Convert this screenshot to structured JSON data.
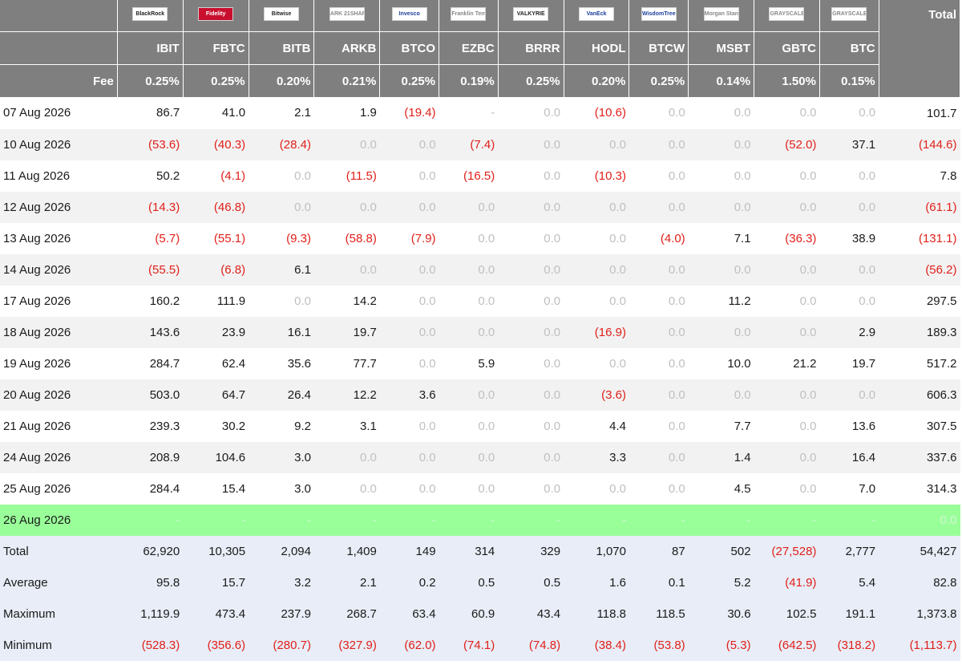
{
  "header": {
    "total_label": "Total",
    "fee_label": "Fee",
    "logos": [
      "BlackRock",
      "Fidelity",
      "Bitwise",
      "ARK 21SHARES",
      "Invesco",
      "Franklin Templeton",
      "VALKYRIE",
      "VanEck",
      "WisdomTree",
      "Morgan Stanley",
      "GRAYSCALE",
      "GRAYSCALE"
    ],
    "tickers": [
      "IBIT",
      "FBTC",
      "BITB",
      "ARKB",
      "BTCO",
      "EZBC",
      "BRRR",
      "HODL",
      "BTCW",
      "MSBT",
      "GBTC",
      "BTC"
    ],
    "fees": [
      "0.25%",
      "0.25%",
      "0.20%",
      "0.21%",
      "0.25%",
      "0.19%",
      "0.25%",
      "0.20%",
      "0.25%",
      "0.14%",
      "1.50%",
      "0.15%"
    ]
  },
  "rows": [
    {
      "date": "07 Aug 2026",
      "values": [
        "86.7",
        "41.0",
        "2.1",
        "1.9",
        "(19.4)",
        "-",
        "0.0",
        "(10.6)",
        "0.0",
        "0.0",
        "0.0",
        "0.0"
      ],
      "total": "101.7"
    },
    {
      "date": "10 Aug 2026",
      "values": [
        "(53.6)",
        "(40.3)",
        "(28.4)",
        "0.0",
        "0.0",
        "(7.4)",
        "0.0",
        "0.0",
        "0.0",
        "0.0",
        "(52.0)",
        "37.1"
      ],
      "total": "(144.6)"
    },
    {
      "date": "11 Aug 2026",
      "values": [
        "50.2",
        "(4.1)",
        "0.0",
        "(11.5)",
        "0.0",
        "(16.5)",
        "0.0",
        "(10.3)",
        "0.0",
        "0.0",
        "0.0",
        "0.0"
      ],
      "total": "7.8"
    },
    {
      "date": "12 Aug 2026",
      "values": [
        "(14.3)",
        "(46.8)",
        "0.0",
        "0.0",
        "0.0",
        "0.0",
        "0.0",
        "0.0",
        "0.0",
        "0.0",
        "0.0",
        "0.0"
      ],
      "total": "(61.1)"
    },
    {
      "date": "13 Aug 2026",
      "values": [
        "(5.7)",
        "(55.1)",
        "(9.3)",
        "(58.8)",
        "(7.9)",
        "0.0",
        "0.0",
        "0.0",
        "(4.0)",
        "7.1",
        "(36.3)",
        "38.9"
      ],
      "total": "(131.1)"
    },
    {
      "date": "14 Aug 2026",
      "values": [
        "(55.5)",
        "(6.8)",
        "6.1",
        "0.0",
        "0.0",
        "0.0",
        "0.0",
        "0.0",
        "0.0",
        "0.0",
        "0.0",
        "0.0"
      ],
      "total": "(56.2)"
    },
    {
      "date": "17 Aug 2026",
      "values": [
        "160.2",
        "111.9",
        "0.0",
        "14.2",
        "0.0",
        "0.0",
        "0.0",
        "0.0",
        "0.0",
        "11.2",
        "0.0",
        "0.0"
      ],
      "total": "297.5"
    },
    {
      "date": "18 Aug 2026",
      "values": [
        "143.6",
        "23.9",
        "16.1",
        "19.7",
        "0.0",
        "0.0",
        "0.0",
        "(16.9)",
        "0.0",
        "0.0",
        "0.0",
        "2.9"
      ],
      "total": "189.3"
    },
    {
      "date": "19 Aug 2026",
      "values": [
        "284.7",
        "62.4",
        "35.6",
        "77.7",
        "0.0",
        "5.9",
        "0.0",
        "0.0",
        "0.0",
        "10.0",
        "21.2",
        "19.7"
      ],
      "total": "517.2"
    },
    {
      "date": "20 Aug 2026",
      "values": [
        "503.0",
        "64.7",
        "26.4",
        "12.2",
        "3.6",
        "0.0",
        "0.0",
        "(3.6)",
        "0.0",
        "0.0",
        "0.0",
        "0.0"
      ],
      "total": "606.3"
    },
    {
      "date": "21 Aug 2026",
      "values": [
        "239.3",
        "30.2",
        "9.2",
        "3.1",
        "0.0",
        "0.0",
        "0.0",
        "4.4",
        "0.0",
        "7.7",
        "0.0",
        "13.6"
      ],
      "total": "307.5"
    },
    {
      "date": "24 Aug 2026",
      "values": [
        "208.9",
        "104.6",
        "3.0",
        "0.0",
        "0.0",
        "0.0",
        "0.0",
        "3.3",
        "0.0",
        "1.4",
        "0.0",
        "16.4"
      ],
      "total": "337.6"
    },
    {
      "date": "25 Aug 2026",
      "values": [
        "284.4",
        "15.4",
        "3.0",
        "0.0",
        "0.0",
        "0.0",
        "0.0",
        "0.0",
        "0.0",
        "4.5",
        "0.0",
        "7.0"
      ],
      "total": "314.3"
    },
    {
      "date": "26 Aug 2026",
      "highlight": true,
      "values": [
        "-",
        "-",
        "-",
        "-",
        "-",
        "-",
        "-",
        "-",
        "-",
        "-",
        "-",
        "-"
      ],
      "total": "0.0"
    }
  ],
  "summary": [
    {
      "label": "Total",
      "values": [
        "62,920",
        "10,305",
        "2,094",
        "1,409",
        "149",
        "314",
        "329",
        "1,070",
        "87",
        "502",
        "(27,528)",
        "2,777"
      ],
      "total": "54,427"
    },
    {
      "label": "Average",
      "values": [
        "95.8",
        "15.7",
        "3.2",
        "2.1",
        "0.2",
        "0.5",
        "0.5",
        "1.6",
        "0.1",
        "5.2",
        "(41.9)",
        "5.4"
      ],
      "total": "82.8"
    },
    {
      "label": "Maximum",
      "values": [
        "1,119.9",
        "473.4",
        "237.9",
        "268.7",
        "63.4",
        "60.9",
        "43.4",
        "118.8",
        "118.5",
        "30.6",
        "102.5",
        "191.1"
      ],
      "total": "1,373.8"
    },
    {
      "label": "Minimum",
      "values": [
        "(528.3)",
        "(356.6)",
        "(280.7)",
        "(327.9)",
        "(62.0)",
        "(74.1)",
        "(74.8)",
        "(38.4)",
        "(53.8)",
        "(5.3)",
        "(642.5)",
        "(318.2)"
      ],
      "total": "(1,113.7)"
    }
  ],
  "colors": {
    "header_bg": "#7f7f7f",
    "negative": "#e0201a",
    "zero": "#c0c0c0",
    "highlight_row": "#99ff99",
    "summary_bg": "#e8edf7",
    "alt_row": "#f2f2f2"
  }
}
